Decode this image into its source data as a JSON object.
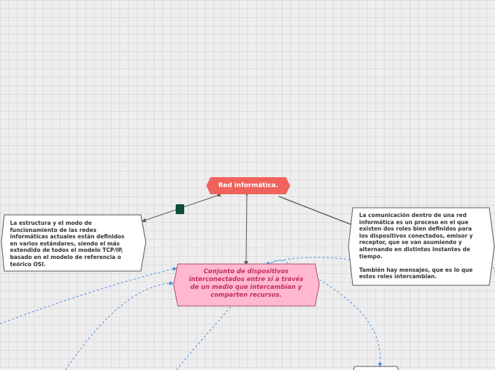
{
  "mindmap": {
    "root": {
      "label": "Red informática.",
      "fill": "#f0625c"
    },
    "left_node": {
      "text": "La estructura y el modo de\nfuncionamiento de las redes\ninformáticas actuales están definidos\nen varios estándares, siendo el más\nextendido de todos el modelo TCP/IP,\nbasado en el modelo de referencia o\nteórico OSI."
    },
    "right_node": {
      "text": "La comunicación dentro de una red\ninformática es un proceso en el que\nexisten dos roles bien definidos para\nlos dispositivos conectados, emisor y\nreceptor, que se van asumiendo y\nalternando en distintos instantes de\ntiempo.\n\nTambién hay mensajes, que es lo que\nestos roles intercambian."
    },
    "center_node": {
      "text": "Conjunto de dispositivos\ninterconectados entre sí a través\nde un medio que intercambian y\ncomparten recursos.",
      "fill": "#ffb8d0",
      "text_color": "#c0305e"
    },
    "marker": {
      "icon": "square-marker-icon",
      "fill": "#0f4a3a"
    },
    "colors": {
      "solid_link": "#555555",
      "dashed_link": "#4a90e2",
      "node_border": "#555555"
    }
  }
}
